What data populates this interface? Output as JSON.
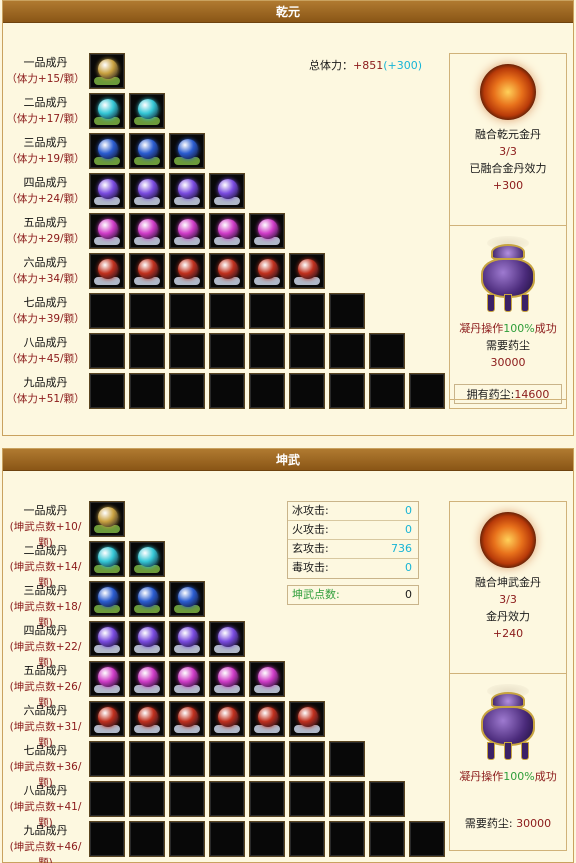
{
  "colors": {
    "header_bg": "#9a6420",
    "bonus": "#8b1a1a",
    "success": "#2f9e3a",
    "cyan": "#18b5d6"
  },
  "grades": [
    {
      "name": "一品成丹",
      "orb": "gold-pill-icon",
      "color": "#c9a140",
      "base": "#6b9a3a"
    },
    {
      "name": "二品成丹",
      "orb": "cyan-pill-icon",
      "color": "#34c7d6",
      "base": "#6b9a3a"
    },
    {
      "name": "三品成丹",
      "orb": "blue-pill-icon",
      "color": "#2a5cd0",
      "base": "#6b9a3a"
    },
    {
      "name": "四品成丹",
      "orb": "violet-pill-icon",
      "color": "#7a4be0",
      "base": "#b0b8c8"
    },
    {
      "name": "五品成丹",
      "orb": "magenta-pill-icon",
      "color": "#d03cc8",
      "base": "#b0b8c8"
    },
    {
      "name": "六品成丹",
      "orb": "red-pill-icon",
      "color": "#c0301e",
      "base": "#b0b8c8"
    },
    {
      "name": "七品成丹",
      "orb": "empty-slot-icon",
      "color": "",
      "base": ""
    },
    {
      "name": "八品成丹",
      "orb": "empty-slot-icon",
      "color": "",
      "base": ""
    },
    {
      "name": "九品成丹",
      "orb": "empty-slot-icon",
      "color": "",
      "base": ""
    }
  ],
  "qianyuan": {
    "title": "乾元",
    "bonuses": [
      "（体力+15/颗）",
      "（体力+17/颗）",
      "（体力+19/颗）",
      "（体力+24/颗）",
      "（体力+29/颗）",
      "（体力+34/颗）",
      "（体力+39/颗）",
      "（体力+45/颗）",
      "（体力+51/颗）"
    ],
    "total_label": "总体力：",
    "total_value": "+851",
    "total_bonus": "(+300)",
    "fuse_title": "融合乾元金丹",
    "fuse_count": "3/3",
    "fused_label": "已融合金丹效力",
    "fused_value": "+300",
    "condense_prefix": "凝丹操作",
    "condense_rate": "100%",
    "condense_suffix": "成功",
    "need_label": "需要药尘",
    "need_value": "30000",
    "own_label": "拥有药尘:",
    "own_value": "14600"
  },
  "kunwu": {
    "title": "坤武",
    "bonuses": [
      "(坤武点数+10/颗)",
      "(坤武点数+14/颗)",
      "(坤武点数+18/颗)",
      "(坤武点数+22/颗)",
      "(坤武点数+26/颗)",
      "(坤武点数+31/颗)",
      "(坤武点数+36/颗)",
      "(坤武点数+41/颗)",
      "(坤武点数+46/颗)"
    ],
    "stats": [
      {
        "label": "冰攻击:",
        "value": "0"
      },
      {
        "label": "火攻击:",
        "value": "0"
      },
      {
        "label": "玄攻击:",
        "value": "736"
      },
      {
        "label": "毒攻击:",
        "value": "0"
      }
    ],
    "points_label": "坤武点数:",
    "points_value": "0",
    "fuse_title": "融合坤武金丹",
    "fuse_count": "3/3",
    "effect_label": "金丹效力",
    "effect_value": "+240",
    "condense_prefix": "凝丹操作",
    "condense_rate": "100%",
    "condense_suffix": "成功",
    "need_label": "需要药尘:",
    "need_value": "30000"
  }
}
